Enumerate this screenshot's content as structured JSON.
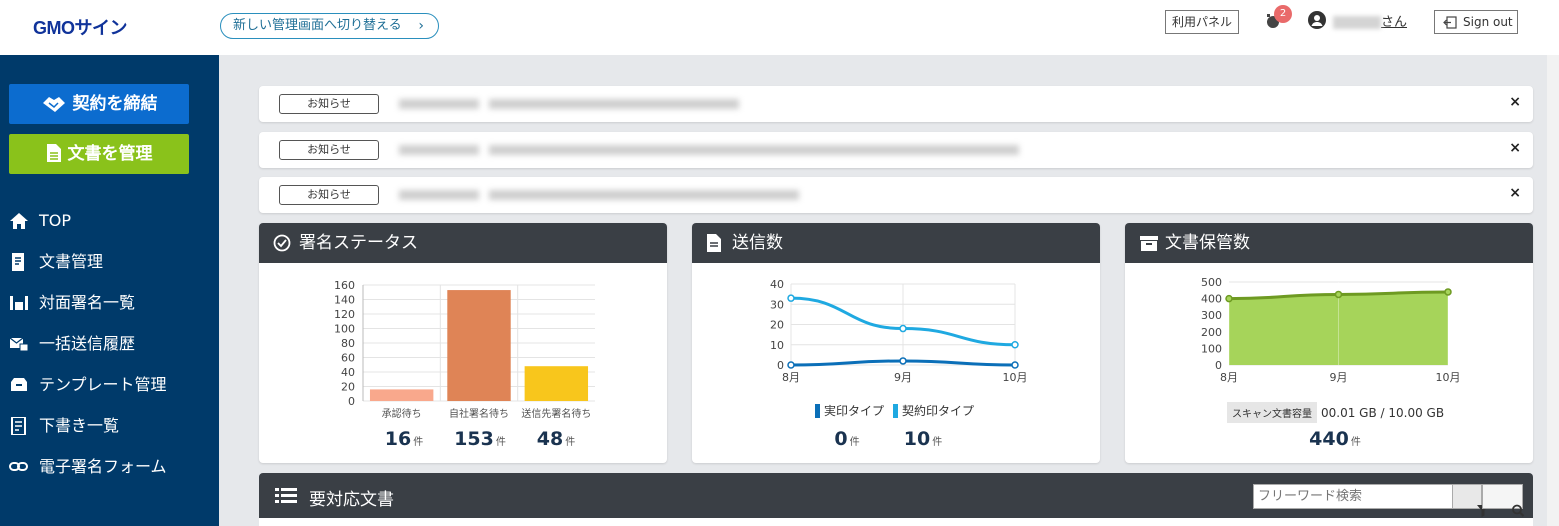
{
  "header": {
    "logo": "GMOサイン",
    "switch_label": "新しい管理画面へ切り替える",
    "switch_chevron": "›",
    "panel_label": "利用パネル",
    "notification_count": "2",
    "user_suffix": "さん",
    "signout_label": "Sign out"
  },
  "sidebar": {
    "contract_btn": "契約を締結",
    "doc_btn": "文書を管理",
    "items": [
      {
        "label": "TOP",
        "icon": "home-icon"
      },
      {
        "label": "文書管理",
        "icon": "document-icon"
      },
      {
        "label": "対面署名一覧",
        "icon": "face-to-face-icon"
      },
      {
        "label": "一括送信履歴",
        "icon": "bulk-send-icon"
      },
      {
        "label": "テンプレート管理",
        "icon": "template-icon"
      },
      {
        "label": "下書き一覧",
        "icon": "draft-icon"
      },
      {
        "label": "電子署名フォーム",
        "icon": "link-icon"
      }
    ]
  },
  "notices": [
    {
      "tag": "お知らせ"
    },
    {
      "tag": "お知らせ"
    },
    {
      "tag": "お知らせ"
    }
  ],
  "close_glyph": "×",
  "cards": {
    "status": {
      "title": "署名ステータス",
      "stats": [
        {
          "num": "16",
          "unit": "件"
        },
        {
          "num": "153",
          "unit": "件"
        },
        {
          "num": "48",
          "unit": "件"
        }
      ]
    },
    "sent": {
      "title": "送信数",
      "legend": [
        "実印タイプ",
        "契約印タイプ"
      ],
      "stats": [
        {
          "num": "0",
          "unit": "件"
        },
        {
          "num": "10",
          "unit": "件"
        }
      ]
    },
    "storage": {
      "title": "文書保管数",
      "scan_label": "スキャン文書容量",
      "scan_value": "00.01 GB / 10.00 GB",
      "stat": {
        "num": "440",
        "unit": "件"
      }
    }
  },
  "bottom": {
    "title": "要対応文書",
    "search_placeholder": "フリーワード検索"
  },
  "colors": {
    "header_dark": "#3a3f45",
    "sidebar": "#003a6a",
    "contract_btn": "#0c6ccf",
    "doc_btn": "#8ac21b",
    "bar_pending": "#f9a88c",
    "bar_own": "#df8456",
    "bar_recipient": "#f8c61c",
    "line_jitsuin": "#0b6fb8",
    "line_contract": "#1fa9e1",
    "area_fill": "#a6d45a",
    "area_line": "#6e9a22"
  },
  "chart_data": [
    {
      "type": "bar",
      "categories": [
        "承認待ち",
        "自社署名待ち",
        "送信先署名待ち"
      ],
      "values": [
        16,
        153,
        48
      ],
      "ylim": [
        0,
        160
      ],
      "yticks": [
        0,
        20,
        40,
        60,
        80,
        100,
        120,
        140,
        160
      ],
      "grid": true
    },
    {
      "type": "line",
      "categories": [
        "8月",
        "9月",
        "10月"
      ],
      "series": [
        {
          "name": "実印タイプ",
          "values": [
            0,
            2,
            0
          ]
        },
        {
          "name": "契約印タイプ",
          "values": [
            33,
            18,
            10
          ]
        }
      ],
      "ylim": [
        0,
        40
      ],
      "yticks": [
        0,
        10,
        20,
        30,
        40
      ],
      "grid": true,
      "legend": "bottom"
    },
    {
      "type": "area",
      "categories": [
        "8月",
        "9月",
        "10月"
      ],
      "values": [
        400,
        425,
        440
      ],
      "ylim": [
        0,
        500
      ],
      "yticks": [
        0,
        100,
        200,
        300,
        400,
        500
      ],
      "grid": true
    }
  ]
}
